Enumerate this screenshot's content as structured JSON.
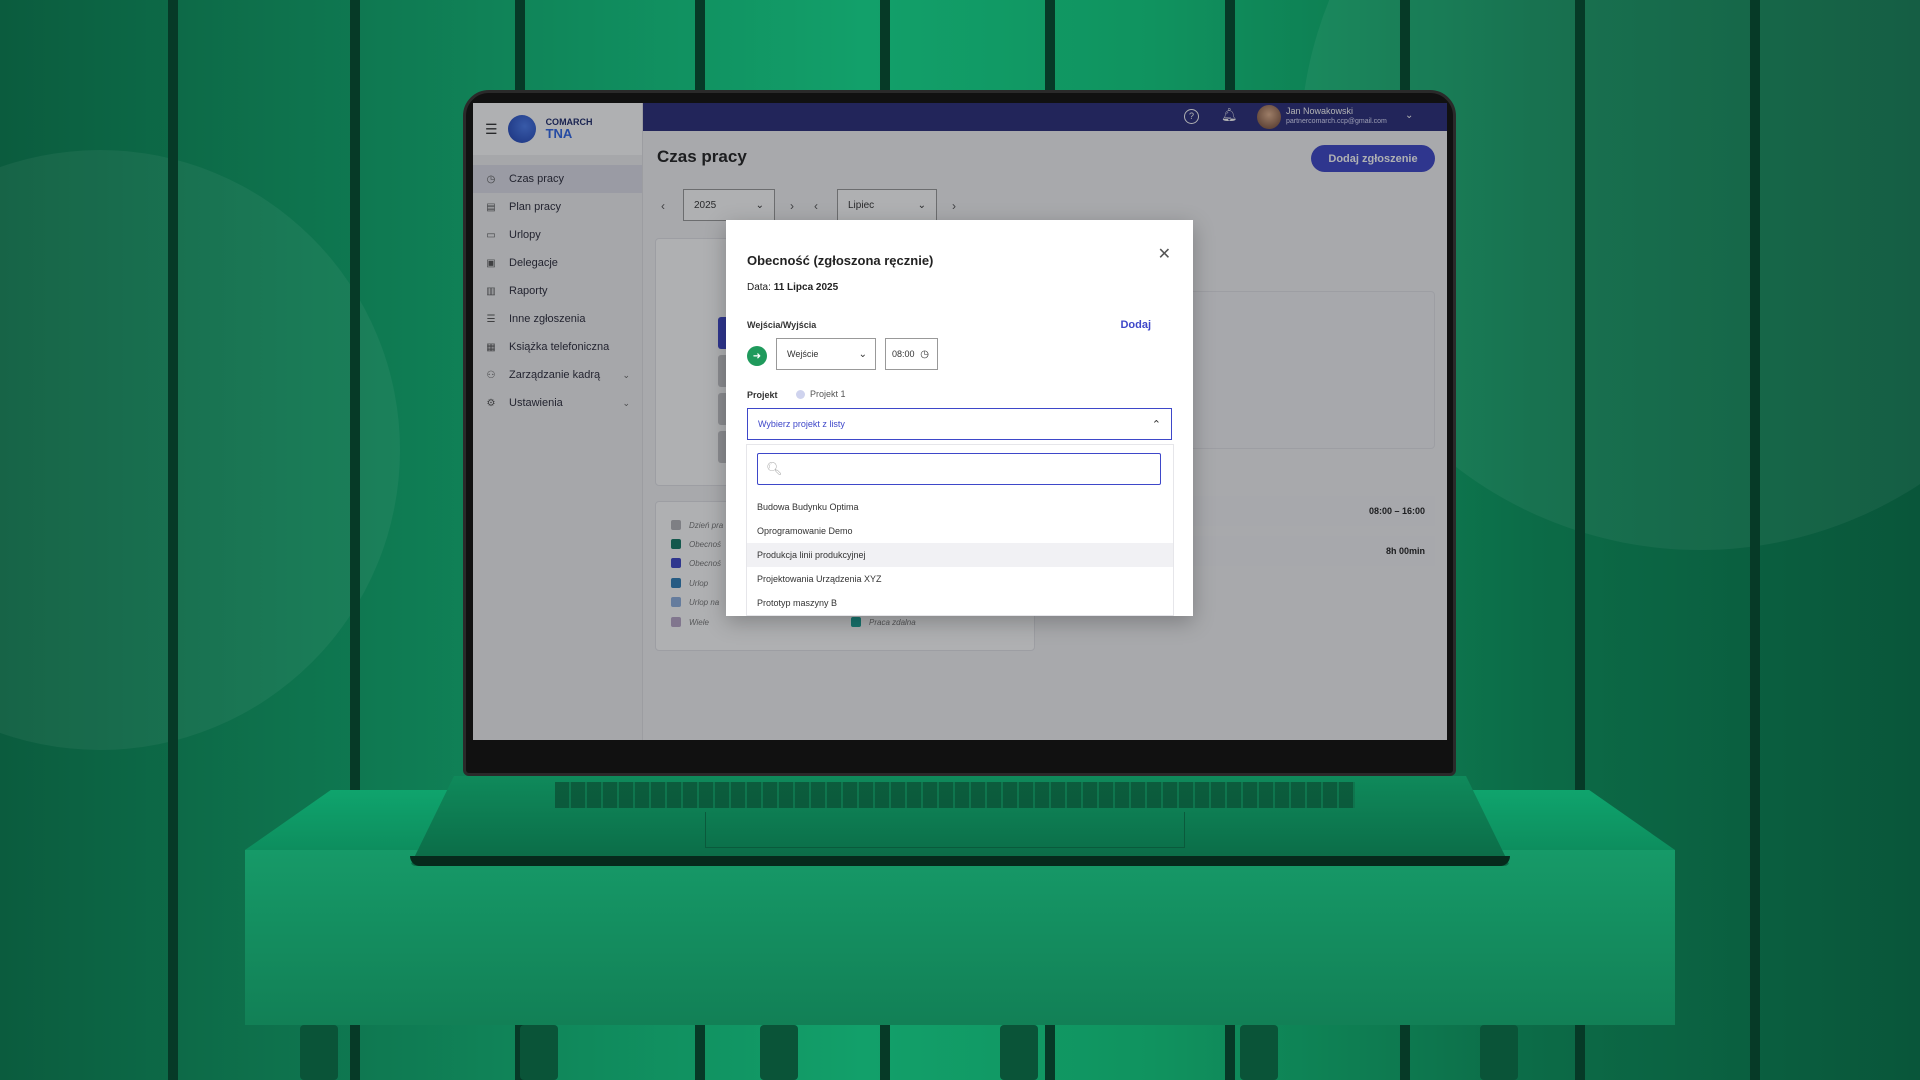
{
  "app": {
    "brand_top": "COMARCH",
    "brand_bottom": "TNA",
    "user_name": "Jan Nowakowski",
    "user_email": "partnercomarch.ccp@gmail.com"
  },
  "sidebar": {
    "items": [
      {
        "label": "Czas pracy",
        "icon": "clock-icon"
      },
      {
        "label": "Plan pracy",
        "icon": "calendar-icon"
      },
      {
        "label": "Urlopy",
        "icon": "suitcase-icon"
      },
      {
        "label": "Delegacje",
        "icon": "bus-icon"
      },
      {
        "label": "Raporty",
        "icon": "clipboard-icon"
      },
      {
        "label": "Inne zgłoszenia",
        "icon": "list-icon"
      },
      {
        "label": "Książka telefoniczna",
        "icon": "phonebook-icon"
      },
      {
        "label": "Zarządzanie kadrą",
        "icon": "people-icon"
      },
      {
        "label": "Ustawienia",
        "icon": "gear-icon"
      }
    ]
  },
  "main": {
    "title": "Czas pracy",
    "add_button": "Dodaj zgłoszenie",
    "year": "2025",
    "month": "Lipiec",
    "time_range": "08:00 – 16:00",
    "duration": "8h 00min",
    "legend": [
      {
        "label": "Dzień pra",
        "color": "#b5b5ba"
      },
      {
        "label": "Obecnoś",
        "color": "#157a66"
      },
      {
        "label": "Obecnoś",
        "color": "#3e47c9"
      },
      {
        "label": "Urlop",
        "color": "#2f7fb8"
      },
      {
        "label": "Urlop na",
        "color": "#8fb0e0"
      },
      {
        "label": "Wiele",
        "color": "#b9a7c9"
      },
      {
        "label": "Praca zdalna",
        "color": "#1aa396"
      }
    ]
  },
  "modal": {
    "title": "Obecność (zgłoszona ręcznie)",
    "date_label": "Data:",
    "date_value": "11 Lipca 2025",
    "entries_label": "Wejścia/Wyjścia",
    "add_link": "Dodaj",
    "entry_type": "Wejście",
    "entry_time": "08:00",
    "project_label": "Projekt",
    "project_selected": "Projekt 1",
    "dropdown_placeholder": "Wybierz projekt z listy",
    "projects": [
      "Budowa Budynku Optima",
      "Oprogramowanie Demo",
      "Produkcja linii produkcyjnej",
      "Projektowania Urządzenia XYZ",
      "Prototyp maszyny B"
    ]
  }
}
